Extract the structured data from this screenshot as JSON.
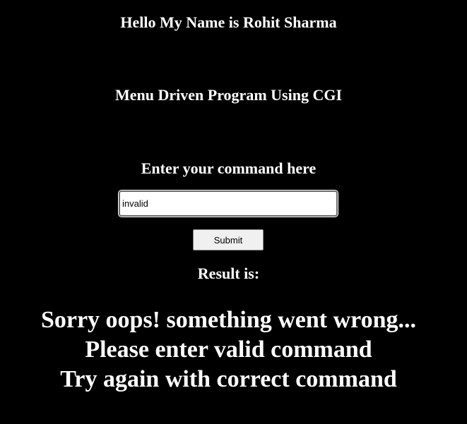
{
  "header": {
    "greeting": "Hello My Name is Rohit Sharma",
    "program_title": "Menu Driven Program Using CGI"
  },
  "form": {
    "command_heading": "Enter your command here",
    "command_value": "invalid",
    "submit_label": "Submit"
  },
  "result": {
    "heading": "Result is:",
    "lines": [
      "Sorry oops! something went wrong...",
      "Please enter valid command",
      "Try again with correct command"
    ]
  },
  "colors": {
    "background": "#000000",
    "text": "#ffffff"
  }
}
